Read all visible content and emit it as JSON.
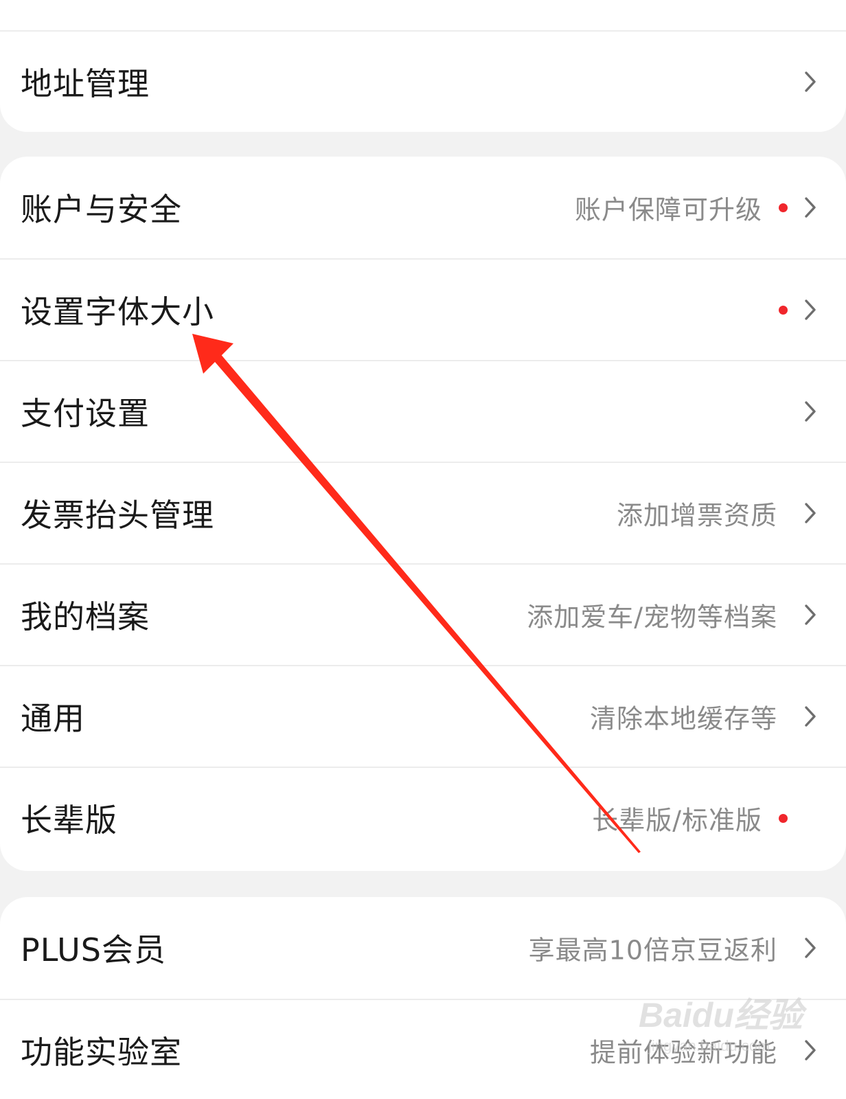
{
  "colors": {
    "background": "#f2f2f2",
    "card": "#ffffff",
    "label": "#1a1a1a",
    "subtext": "#8a8a8a",
    "notification_dot": "#f0262c",
    "annotation_arrow": "#ff2a1a"
  },
  "groups": [
    {
      "items": [
        {
          "label": "地址管理",
          "sub": "",
          "dot": false,
          "chevron": true,
          "icon": "chevron-right-icon"
        }
      ]
    },
    {
      "items": [
        {
          "label": "账户与安全",
          "sub": "账户保障可升级",
          "dot": true,
          "chevron": true,
          "icon": "chevron-right-icon"
        },
        {
          "label": "设置字体大小",
          "sub": "",
          "dot": true,
          "chevron": true,
          "icon": "chevron-right-icon"
        },
        {
          "label": "支付设置",
          "sub": "",
          "dot": false,
          "chevron": true,
          "icon": "chevron-right-icon"
        },
        {
          "label": "发票抬头管理",
          "sub": "添加增票资质",
          "dot": false,
          "chevron": true,
          "icon": "chevron-right-icon"
        },
        {
          "label": "我的档案",
          "sub": "添加爱车/宠物等档案",
          "dot": false,
          "chevron": true,
          "icon": "chevron-right-icon"
        },
        {
          "label": "通用",
          "sub": "清除本地缓存等",
          "dot": false,
          "chevron": true,
          "icon": "chevron-right-icon"
        },
        {
          "label": "长辈版",
          "sub": "长辈版/标准版",
          "dot": true,
          "chevron": false,
          "icon": ""
        }
      ]
    },
    {
      "items": [
        {
          "label": "PLUS会员",
          "sub": "享最高10倍京豆返利",
          "dot": false,
          "chevron": true,
          "icon": "chevron-right-icon"
        },
        {
          "label": "功能实验室",
          "sub": "提前体验新功能",
          "dot": false,
          "chevron": true,
          "icon": "chevron-right-icon"
        }
      ]
    }
  ],
  "annotation": {
    "icon": "red-arrow-icon",
    "target": "设置字体大小"
  },
  "watermark": {
    "main": "Baidu经验",
    "sub": "jingyan.baidu.com"
  }
}
